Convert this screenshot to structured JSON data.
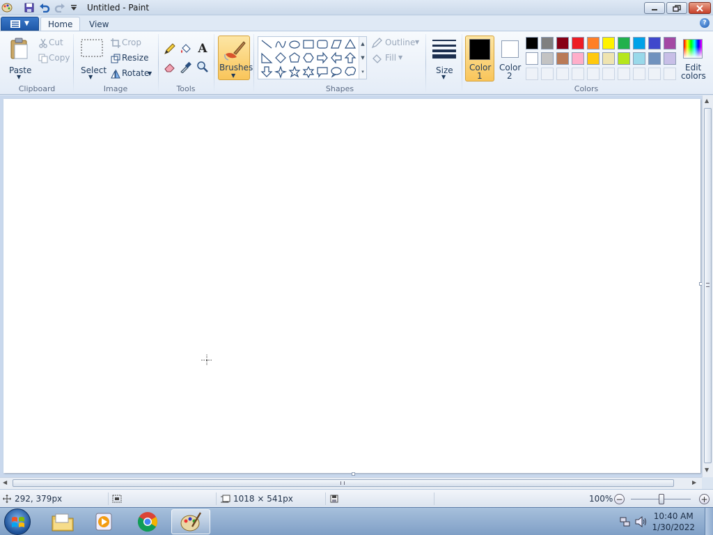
{
  "window": {
    "title": "Untitled - Paint"
  },
  "tabs": [
    {
      "label": "Home"
    },
    {
      "label": "View"
    }
  ],
  "clipboard": {
    "group_label": "Clipboard",
    "paste": "Paste",
    "cut": "Cut",
    "copy": "Copy"
  },
  "image": {
    "group_label": "Image",
    "select": "Select",
    "crop": "Crop",
    "resize": "Resize",
    "rotate": "Rotate"
  },
  "tools": {
    "group_label": "Tools",
    "text_tool_glyph": "A"
  },
  "brushes": {
    "label": "Brushes"
  },
  "shapes": {
    "group_label": "Shapes",
    "outline": "Outline",
    "fill": "Fill"
  },
  "size": {
    "label": "Size"
  },
  "colors": {
    "group_label": "Colors",
    "color1_line1": "Color",
    "color1_line2": "1",
    "color2_line1": "Color",
    "color2_line2": "2",
    "edit_line1": "Edit",
    "edit_line2": "colors",
    "color1_value": "#000000",
    "color2_value": "#ffffff",
    "palette_row1": [
      "#000000",
      "#7f7f7f",
      "#880015",
      "#ed1c24",
      "#ff7f27",
      "#fff200",
      "#22b14c",
      "#00a2e8",
      "#3f48cc",
      "#a349a4"
    ],
    "palette_row2": [
      "#ffffff",
      "#c3c3c3",
      "#b97a57",
      "#ffaec9",
      "#ffc90e",
      "#efe4b0",
      "#b5e61d",
      "#99d9ea",
      "#7092be",
      "#c8bfe7"
    ]
  },
  "status": {
    "cursor_pos": "292, 379px",
    "canvas_size": "1018 × 541px",
    "zoom": "100%"
  },
  "clock": {
    "time": "10:40 AM",
    "date": "1/30/2022"
  }
}
